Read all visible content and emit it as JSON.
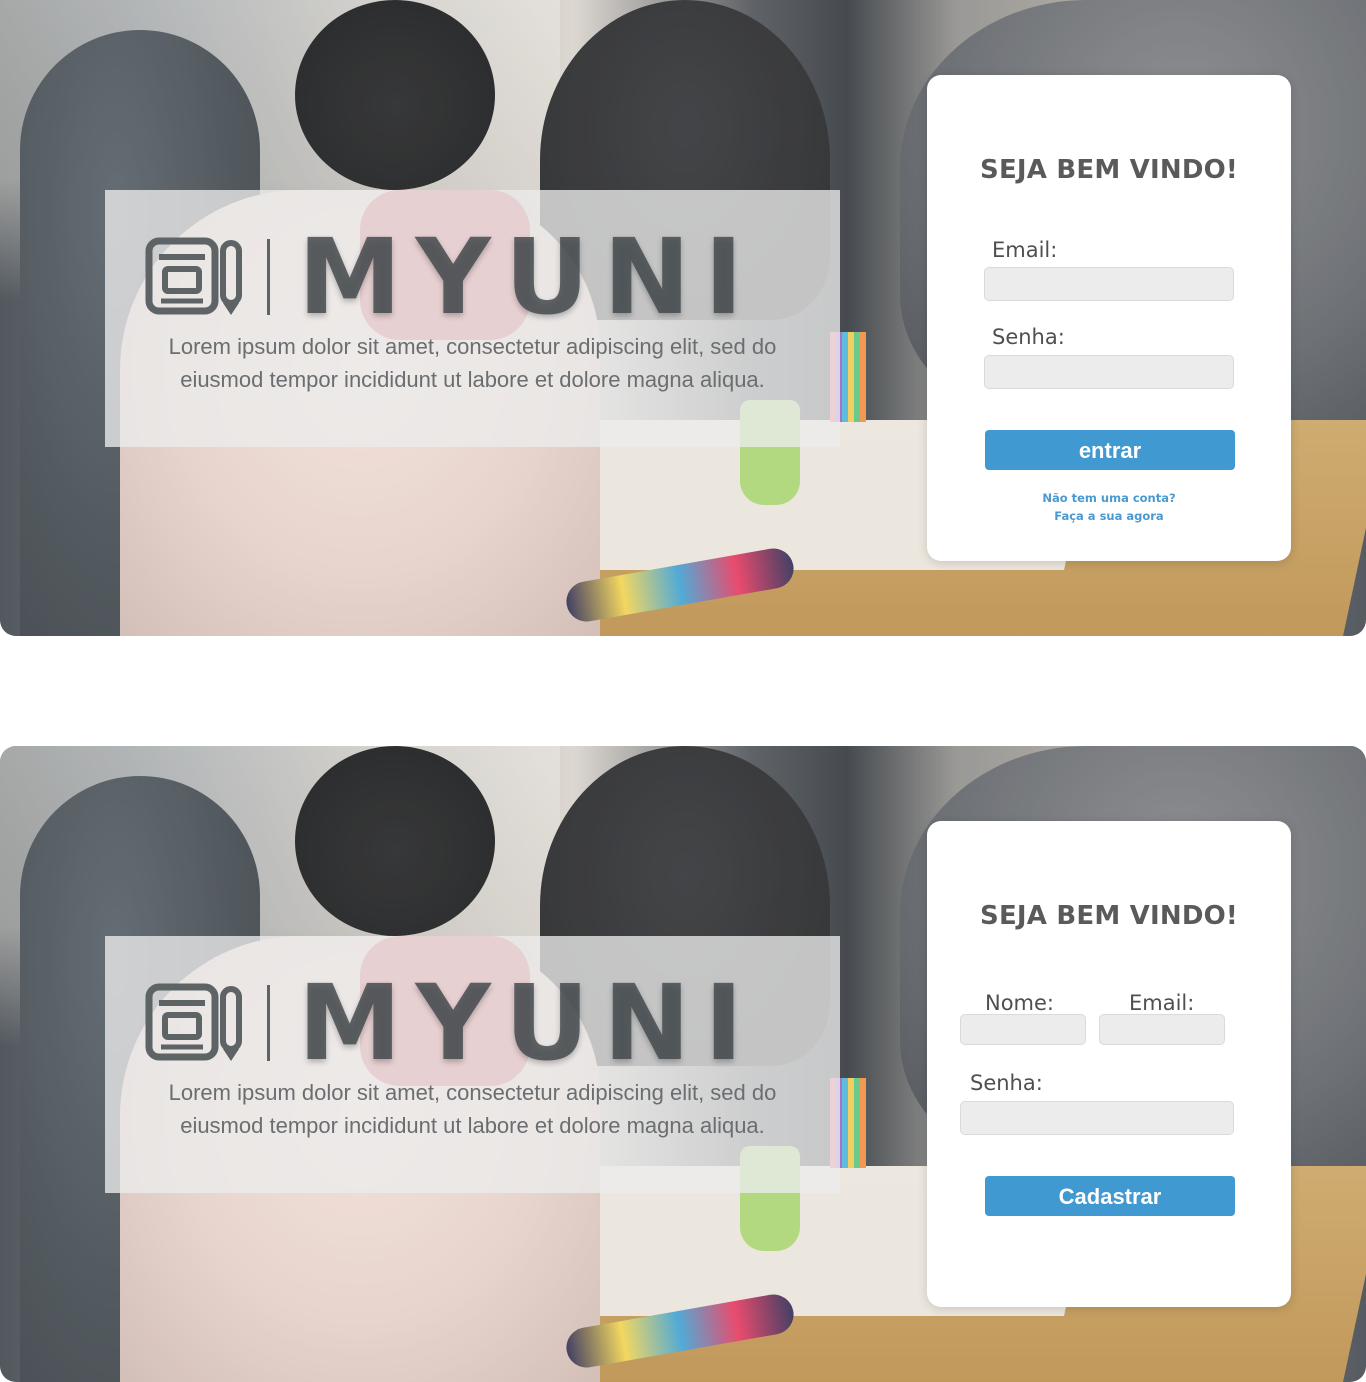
{
  "login": {
    "brand": "MYUNI",
    "tagline": "Lorem ipsum dolor sit amet, consectetur adipiscing elit, sed do eiusmod tempor incididunt ut labore et dolore magna aliqua.",
    "welcome": "SEJA BEM VINDO!",
    "email_label": "Email:",
    "email_value": "",
    "password_label": "Senha:",
    "password_value": "",
    "submit_label": "entrar",
    "no_account": "Não tem uma conta?",
    "signup_link": "Faça a sua agora"
  },
  "register": {
    "brand": "MYUNI",
    "tagline": "Lorem ipsum dolor sit amet, consectetur adipiscing elit, sed do eiusmod tempor incididunt ut labore et dolore magna aliqua.",
    "welcome": "SEJA BEM VINDO!",
    "name_label": "Nome:",
    "name_value": "",
    "email_label": "Email:",
    "email_value": "",
    "password_label": "Senha:",
    "password_value": "",
    "submit_label": "Cadastrar"
  },
  "colors": {
    "accent": "#4199d1",
    "link": "#4a9ad1",
    "card": "#ffffff"
  },
  "icons": {
    "logo": "newspaper-pencil-icon"
  }
}
